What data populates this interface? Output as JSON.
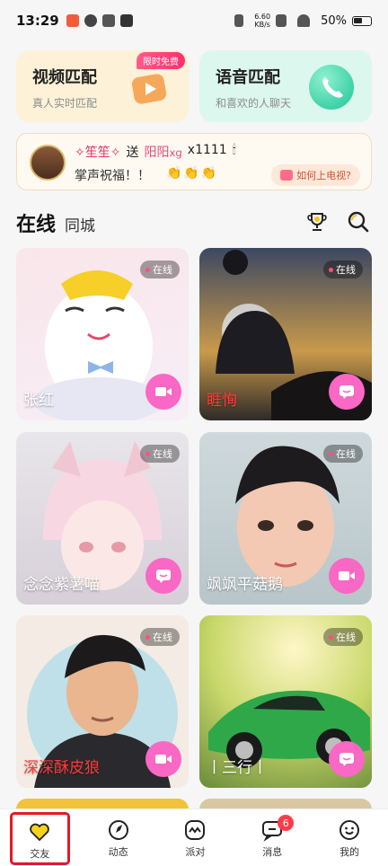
{
  "status_bar": {
    "time": "13:29",
    "net_speed_value": "6.60",
    "net_speed_unit": "KB/s",
    "battery": "50%"
  },
  "match_cards": {
    "video": {
      "title": "视频匹配",
      "subtitle": "真人实时匹配",
      "badge": "限时免费"
    },
    "voice": {
      "title": "语音匹配",
      "subtitle": "和喜欢的人聊天"
    }
  },
  "gift_banner": {
    "sender": "✧笙笙✧",
    "verb": "送",
    "receiver": "阳阳",
    "receiver_suffix": "xg",
    "amount": "x1111",
    "message": "掌声祝福！！",
    "tv_link": "如何上电视?"
  },
  "tabs": {
    "active": "在线",
    "other": "同城"
  },
  "users": [
    {
      "name": "张红",
      "status": "在线",
      "action_icon": "video-icon",
      "name_color": "white"
    },
    {
      "name": "睚恂",
      "status": "在线",
      "action_icon": "chat-icon",
      "name_color": "red"
    },
    {
      "name": "念念紫薯喵",
      "status": "在线",
      "action_icon": "chat-icon",
      "name_color": "white"
    },
    {
      "name": "飒飒平菇鹅",
      "status": "在线",
      "action_icon": "video-icon",
      "name_color": "white"
    },
    {
      "name": "深深酥皮狼",
      "status": "在线",
      "action_icon": "video-icon",
      "name_color": "red"
    },
    {
      "name": "丨三行丨",
      "status": "在线",
      "action_icon": "chat-icon",
      "name_color": "white"
    }
  ],
  "nav": {
    "items": [
      {
        "label": "交友",
        "icon": "heart-icon",
        "active": true
      },
      {
        "label": "动态",
        "icon": "compass-icon"
      },
      {
        "label": "派对",
        "icon": "party-icon"
      },
      {
        "label": "消息",
        "icon": "message-icon",
        "badge": "6"
      },
      {
        "label": "我的",
        "icon": "smile-icon"
      }
    ]
  },
  "colors": {
    "accent_pink": "#f868c4",
    "active_outline": "#e3182b",
    "online_dot": "#ff4f7a"
  }
}
